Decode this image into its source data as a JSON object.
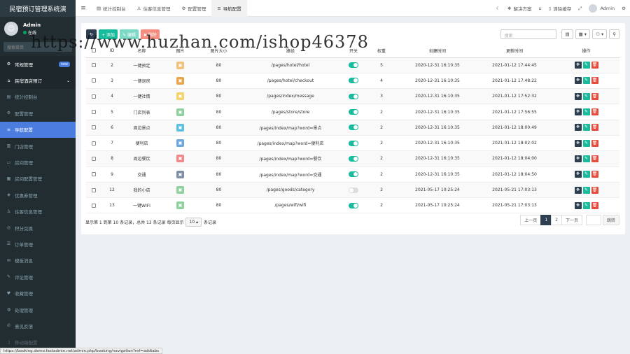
{
  "app": {
    "title": "民宿预订管理系统演",
    "user_name": "Admin",
    "user_status": "在线",
    "search_placeholder": "搜索菜单"
  },
  "sidebar": {
    "items": [
      {
        "label": "常规管理",
        "icon": "gear-icon",
        "glyph": "⚙",
        "kind": "white",
        "badge": "new"
      },
      {
        "label": "民宿酒店预订",
        "icon": "home-icon",
        "glyph": "⌂",
        "kind": "white",
        "caret": "⌄"
      },
      {
        "label": "统计控制台",
        "icon": "chart-icon",
        "glyph": "▤",
        "kind": ""
      },
      {
        "label": "配置管理",
        "icon": "gear-icon",
        "glyph": "⚙",
        "kind": ""
      },
      {
        "label": "导航配置",
        "icon": "list-icon",
        "glyph": "≡",
        "kind": "active"
      },
      {
        "label": "门店管理",
        "icon": "bank-icon",
        "glyph": "▥",
        "kind": ""
      },
      {
        "label": "房间管理",
        "icon": "bed-icon",
        "glyph": "▭",
        "kind": ""
      },
      {
        "label": "房间配置管理",
        "icon": "grid-icon",
        "glyph": "▦",
        "kind": ""
      },
      {
        "label": "优惠券管理",
        "icon": "ticket-icon",
        "glyph": "◈",
        "kind": ""
      },
      {
        "label": "住客信息管理",
        "icon": "user-icon",
        "glyph": "♙",
        "kind": ""
      },
      {
        "label": "积分兑换",
        "icon": "gift-icon",
        "glyph": "◎",
        "kind": ""
      },
      {
        "label": "订单管理",
        "icon": "order-icon",
        "glyph": "☰",
        "kind": ""
      },
      {
        "label": "模板消息",
        "icon": "message-icon",
        "glyph": "✉",
        "kind": ""
      },
      {
        "label": "评论管理",
        "icon": "comment-icon",
        "glyph": "✎",
        "kind": ""
      },
      {
        "label": "收藏管理",
        "icon": "heart-icon",
        "glyph": "♥",
        "kind": ""
      },
      {
        "label": "处理管理",
        "icon": "globe-icon",
        "glyph": "◍",
        "kind": ""
      },
      {
        "label": "意见反馈",
        "icon": "feedback-icon",
        "glyph": "✆",
        "kind": ""
      },
      {
        "label": "移动端配置",
        "icon": "mobile-icon",
        "glyph": "▯",
        "kind": "faded"
      }
    ]
  },
  "topbar": {
    "tabs": [
      {
        "label": "统计控制台",
        "icon": "chart-icon",
        "glyph": "▤",
        "active": false
      },
      {
        "label": "住客信息管理",
        "icon": "user-icon",
        "glyph": "♙",
        "active": false
      },
      {
        "label": "配置管理",
        "icon": "gear-icon",
        "glyph": "⚙",
        "active": false
      },
      {
        "label": "导航配置",
        "icon": "list-icon",
        "glyph": "≡",
        "active": true
      }
    ],
    "right": {
      "solutions": "解决方案",
      "clear_cache": "清除缓存",
      "user": "Admin"
    }
  },
  "toolbar": {
    "refresh": "↻",
    "add": "+ 添加",
    "edit": "✎ 编辑",
    "delete": "✖ 删除",
    "search_placeholder": "搜索"
  },
  "table": {
    "columns": [
      "",
      "ID",
      "名称",
      "图片",
      "图片大小",
      "路径",
      "开关",
      "权重",
      "创建时间",
      "更新时间",
      "操作"
    ],
    "rows": [
      {
        "id": "2",
        "name": "一键预定",
        "thumb_color": "#f0c27b",
        "size": "80",
        "path": "/pages/hotel/hotel",
        "on": true,
        "weight": "5",
        "created": "2020-12-31 16:10:35",
        "updated": "2021-01-12 17:44:45"
      },
      {
        "id": "3",
        "name": "一键退房",
        "thumb_color": "#e8a54b",
        "size": "80",
        "path": "/pages/hotel/checkout",
        "on": true,
        "weight": "4",
        "created": "2020-12-31 16:10:35",
        "updated": "2021-01-12 17:48:22"
      },
      {
        "id": "4",
        "name": "一键社情",
        "thumb_color": "#f5d36b",
        "size": "80",
        "path": "/pages/index/message",
        "on": true,
        "weight": "3",
        "created": "2020-12-31 16:10:35",
        "updated": "2021-01-12 17:52:32"
      },
      {
        "id": "5",
        "name": "门店列表",
        "thumb_color": "#8fd19e",
        "size": "80",
        "path": "/pages/store/store",
        "on": true,
        "weight": "2",
        "created": "2020-12-31 16:10:35",
        "updated": "2021-01-12 17:56:55"
      },
      {
        "id": "6",
        "name": "周边景点",
        "thumb_color": "#5bc0de",
        "size": "80",
        "path": "/pages/index/map?word=景点",
        "on": true,
        "weight": "2",
        "created": "2020-12-31 16:10:35",
        "updated": "2021-01-12 18:00:49"
      },
      {
        "id": "7",
        "name": "便利店",
        "thumb_color": "#6fa8dc",
        "size": "80",
        "path": "/pages/index/map?word=便利店",
        "on": true,
        "weight": "2",
        "created": "2020-12-31 16:10:35",
        "updated": "2021-01-12 18:02:02"
      },
      {
        "id": "8",
        "name": "周边餐饮",
        "thumb_color": "#f08a8a",
        "size": "80",
        "path": "/pages/index/map?word=餐饮",
        "on": true,
        "weight": "2",
        "created": "2020-12-31 16:10:35",
        "updated": "2021-01-12 18:04:00"
      },
      {
        "id": "9",
        "name": "交通",
        "thumb_color": "#7f8fa6",
        "size": "80",
        "path": "/pages/index/map?word=交通",
        "on": true,
        "weight": "2",
        "created": "2020-12-31 16:10:35",
        "updated": "2021-01-12 18:04:50"
      },
      {
        "id": "12",
        "name": "我的小店",
        "thumb_color": "#8fd19e",
        "size": "80",
        "path": "/pages/goods/category",
        "on": false,
        "weight": "2",
        "created": "2021-05-17 10:25:24",
        "updated": "2021-05-21 17:03:13"
      },
      {
        "id": "13",
        "name": "一键WIFI",
        "thumb_color": "#8fd19e",
        "size": "80",
        "path": "/pages/wifi/wifi",
        "on": true,
        "weight": "2",
        "created": "2021-05-17 10:25:24",
        "updated": "2021-05-21 17:03:13"
      }
    ]
  },
  "pagination": {
    "info_prefix": "显示第 1 到第 10 条记录，总共 13 条记录 每页显示",
    "page_size": "10 ▴",
    "info_suffix": "条记录",
    "prev": "上一页",
    "pages": [
      "1",
      "2"
    ],
    "current": "1",
    "next": "下一页",
    "go": "跳转"
  },
  "watermark": "https://www.huzhan.com/ishop46378",
  "statusbar": "https://booking.demo.fastadmin.net/admin.php/booking/navigation?ref=addtabs",
  "colors": {
    "sidebar": "#222d32",
    "active": "#4b7ddf",
    "green": "#18bc9c",
    "navy": "#2c3e50",
    "red": "#e74c3c"
  }
}
